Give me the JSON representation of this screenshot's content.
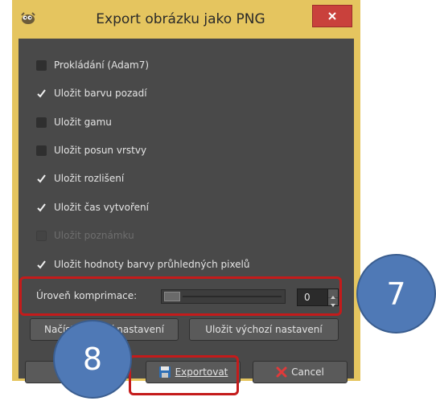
{
  "window": {
    "title": "Export obrázku jako PNG"
  },
  "options": [
    {
      "label": "Prokládání (Adam7)",
      "checked": false,
      "disabled": false
    },
    {
      "label": "Uložit barvu pozadí",
      "checked": true,
      "disabled": false
    },
    {
      "label": "Uložit gamu",
      "checked": false,
      "disabled": false
    },
    {
      "label": "Uložit posun vrstvy",
      "checked": false,
      "disabled": false
    },
    {
      "label": "Uložit rozlišení",
      "checked": true,
      "disabled": false
    },
    {
      "label": "Uložit čas vytvoření",
      "checked": true,
      "disabled": false
    },
    {
      "label": "Uložit poznámku",
      "checked": false,
      "disabled": true
    },
    {
      "label": "Uložit hodnoty barvy průhledných pixelů",
      "checked": true,
      "disabled": false
    }
  ],
  "compression": {
    "label": "Úroveň komprimace:",
    "value": "0"
  },
  "buttons": {
    "load_defaults": "Načíst výchozí nastavení",
    "save_defaults": "Uložit výchozí nastavení",
    "export": "Exportovat",
    "cancel": "Cancel"
  },
  "annotations": {
    "badge_7": "7",
    "badge_8": "8",
    "highlight_color": "#c41b1b",
    "badge_color": "#4f79b6"
  }
}
